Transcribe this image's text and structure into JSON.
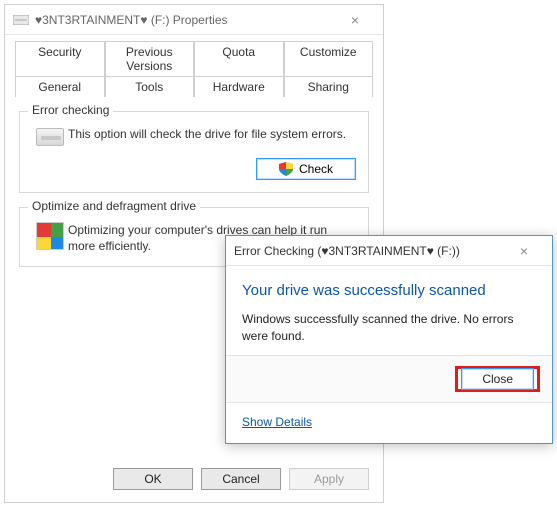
{
  "propWin": {
    "title": "♥3NT3RTAINMENT♥ (F:) Properties",
    "tabsTop": [
      "Security",
      "Previous Versions",
      "Quota",
      "Customize"
    ],
    "tabsBottom": [
      "General",
      "Tools",
      "Hardware",
      "Sharing"
    ],
    "activeTab": "Tools",
    "errorChecking": {
      "title": "Error checking",
      "desc": "This option will check the drive for file system errors.",
      "button": "Check"
    },
    "defrag": {
      "title": "Optimize and defragment drive",
      "desc": "Optimizing your computer's drives can help it run more efficiently."
    },
    "buttons": {
      "ok": "OK",
      "cancel": "Cancel",
      "apply": "Apply"
    }
  },
  "dialog": {
    "title": "Error Checking (♥3NT3RTAINMENT♥ (F:))",
    "heading": "Your drive was successfully scanned",
    "message": "Windows successfully scanned the drive. No errors were found.",
    "close": "Close",
    "showDetails": "Show Details"
  }
}
